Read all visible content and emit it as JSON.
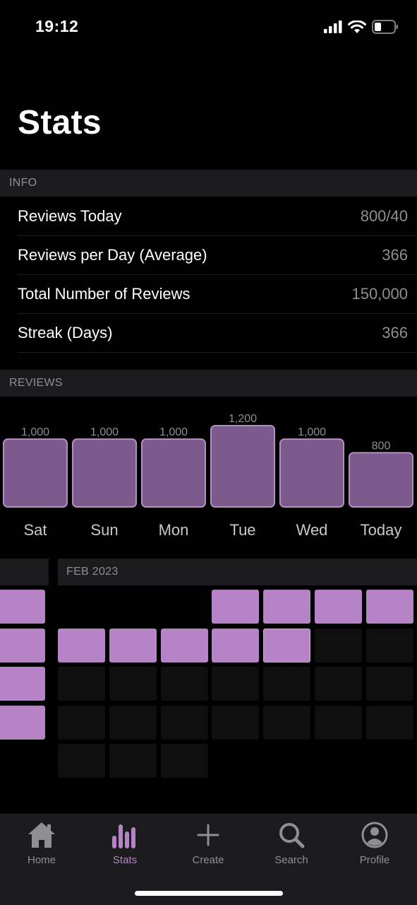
{
  "status": {
    "time": "19:12"
  },
  "page": {
    "title": "Stats"
  },
  "info": {
    "header": "INFO",
    "rows": [
      {
        "label": "Reviews Today",
        "value": "800/40"
      },
      {
        "label": "Reviews per Day (Average)",
        "value": "366"
      },
      {
        "label": "Total Number of Reviews",
        "value": "150,000"
      },
      {
        "label": "Streak (Days)",
        "value": "366"
      }
    ]
  },
  "reviews": {
    "header": "REVIEWS"
  },
  "chart_data": {
    "type": "bar",
    "categories": [
      "Sat",
      "Sun",
      "Mon",
      "Tue",
      "Wed",
      "Today"
    ],
    "values": [
      1000,
      1000,
      1000,
      1200,
      1000,
      800
    ],
    "value_labels": [
      "1,000",
      "1,000",
      "1,000",
      "1,200",
      "1,000",
      "800"
    ],
    "ylim": [
      0,
      1200
    ],
    "bar_color": "#7d5a8c",
    "bar_edge_color": "#b48fc2",
    "grid": false
  },
  "calendar": {
    "month_label": "FEB 2023",
    "active_color": "#b583c6",
    "inactive_color": "#0f0f10",
    "prev_month_active_weeks": 4,
    "weeks": [
      [
        null,
        null,
        null,
        1,
        1,
        1,
        1
      ],
      [
        1,
        1,
        1,
        1,
        "today",
        0,
        0
      ],
      [
        0,
        0,
        0,
        0,
        0,
        0,
        0
      ],
      [
        0,
        0,
        0,
        0,
        0,
        0,
        0
      ],
      [
        0,
        0,
        0,
        null,
        null,
        null,
        null
      ]
    ]
  },
  "tabs": [
    {
      "label": "Home",
      "icon": "home-icon",
      "active": false
    },
    {
      "label": "Stats",
      "icon": "stats-icon",
      "active": true
    },
    {
      "label": "Create",
      "icon": "plus-icon",
      "active": false
    },
    {
      "label": "Search",
      "icon": "search-icon",
      "active": false
    },
    {
      "label": "Profile",
      "icon": "profile-icon",
      "active": false
    }
  ],
  "colors": {
    "accent": "#b583c6",
    "background": "#000000",
    "section": "#1c1c1e",
    "secondary_text": "#8e8e93"
  }
}
